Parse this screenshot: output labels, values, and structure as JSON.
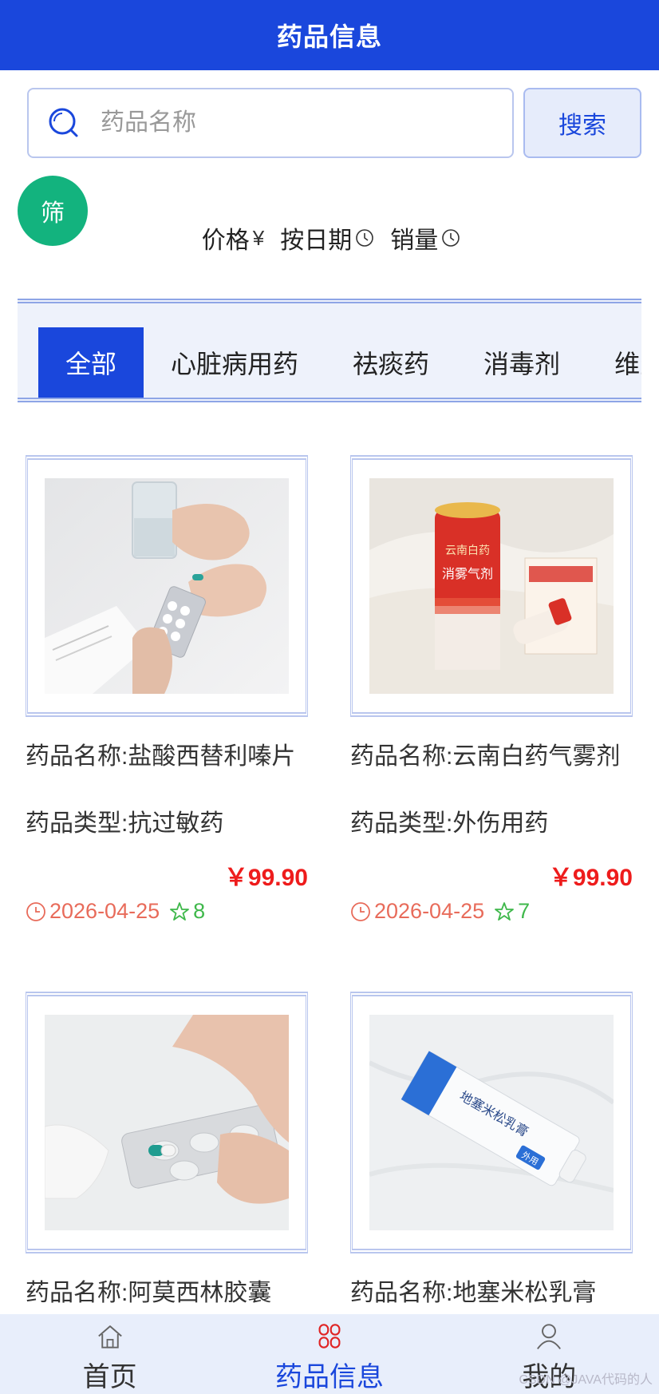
{
  "navbar": {
    "title": "药品信息"
  },
  "search": {
    "placeholder": "药品名称",
    "button_label": "搜索"
  },
  "filter": {
    "label": "筛"
  },
  "sort": {
    "price_label": "价格",
    "price_symbol": "¥",
    "date_label": "按日期",
    "sales_label": "销量"
  },
  "categories": {
    "items": [
      "全部",
      "心脏病用药",
      "祛痰药",
      "消毒剂",
      "维生"
    ],
    "active_index": 0
  },
  "products": [
    {
      "name": "药品名称:盐酸西替利嗪片",
      "type": "药品类型:抗过敏药",
      "price": "￥99.90",
      "date": "2026-04-25",
      "rating": "8"
    },
    {
      "name": "药品名称:云南白药气雾剂",
      "type": "药品类型:外伤用药",
      "price": "￥99.90",
      "date": "2026-04-25",
      "rating": "7"
    },
    {
      "name": "药品名称:阿莫西林胶囊"
    },
    {
      "name": "药品名称:地塞米松乳膏"
    }
  ],
  "product_images": {
    "can_brand": "云南白药",
    "can_text": "消雾气剂",
    "tube_text": "地塞米松乳膏",
    "tube_tag": "外用"
  },
  "tabbar": {
    "items": [
      "首页",
      "药品信息",
      "我的"
    ],
    "active_index": 1
  },
  "watermark": "CSDN @JAVA代码的人",
  "colors": {
    "primary": "#1a47dc",
    "fab": "#13b37e",
    "price": "#ee1c1c",
    "date": "#e86b5a",
    "rating": "#3fb84b"
  },
  "icons": [
    "search-icon",
    "clock-icon",
    "star-icon",
    "home-icon",
    "grid-icon",
    "user-icon"
  ]
}
